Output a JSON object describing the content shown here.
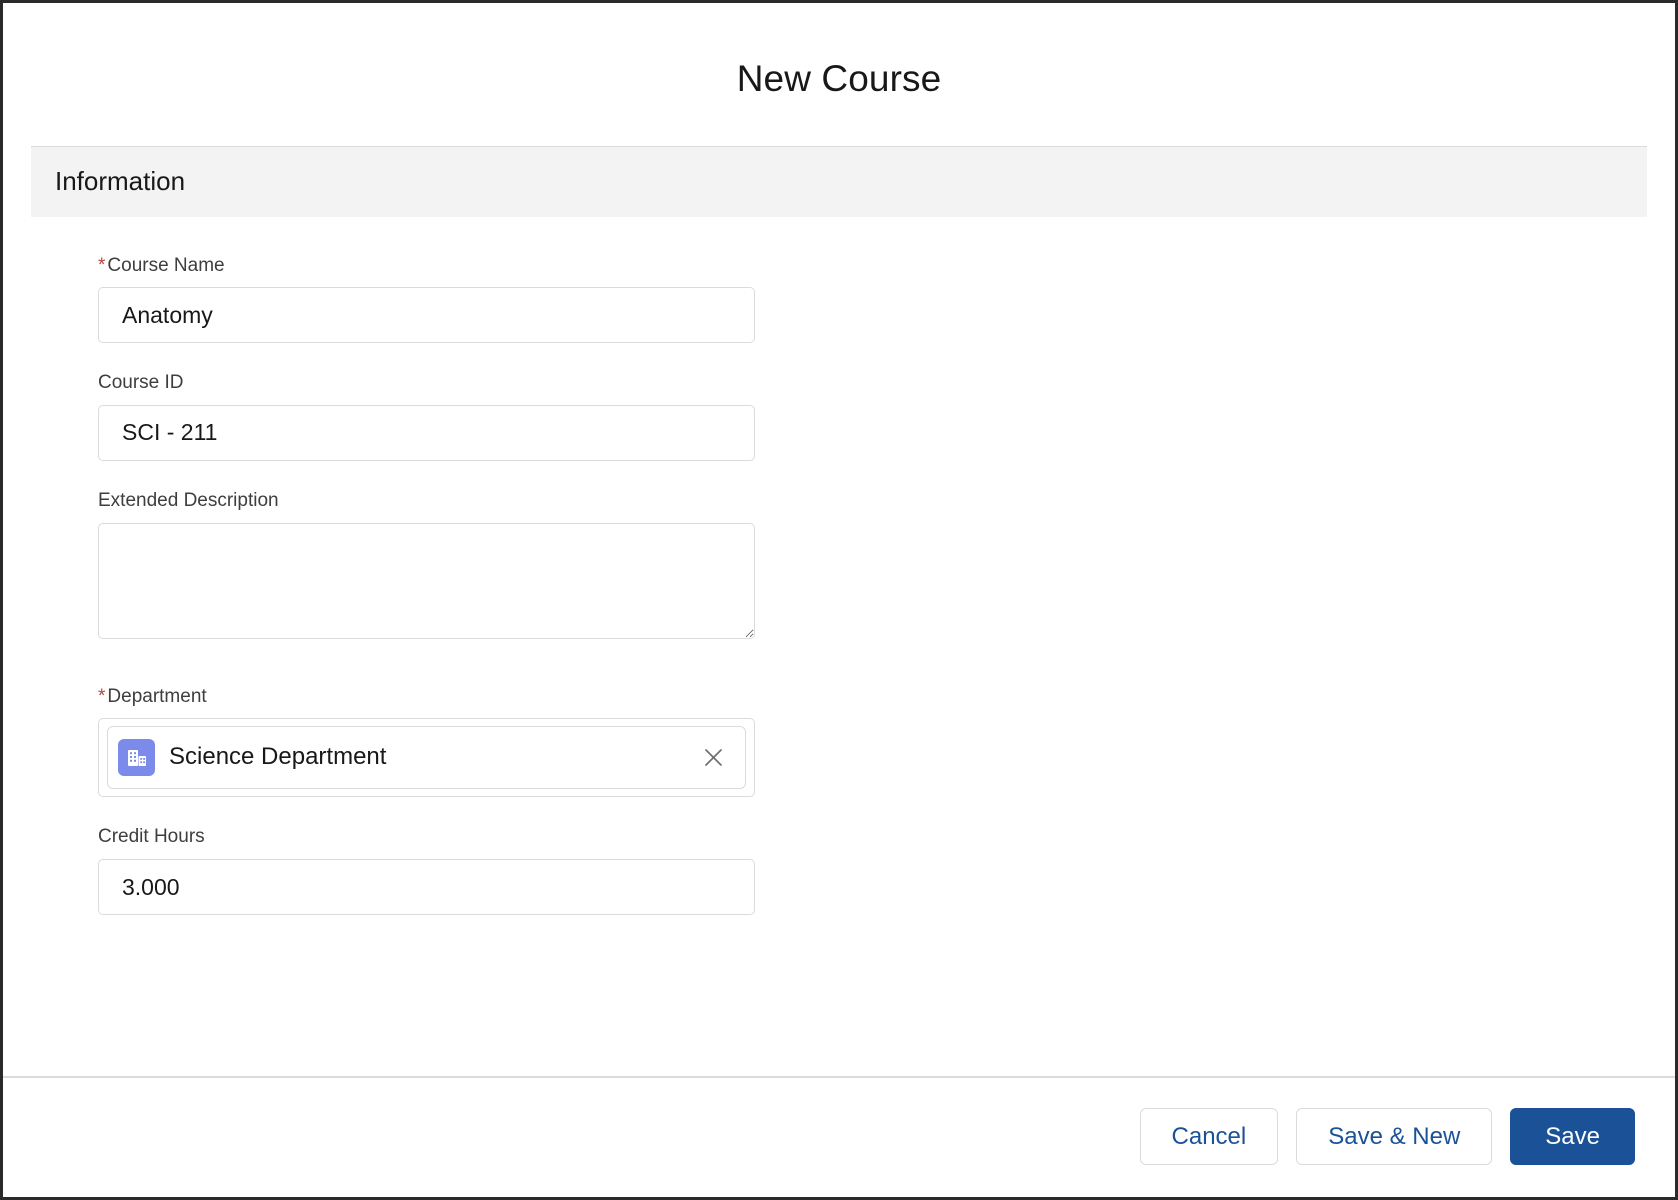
{
  "modal": {
    "title": "New Course",
    "section": {
      "heading": "Information"
    },
    "fields": {
      "course_name": {
        "label": "Course Name",
        "required_marker": "*",
        "value": "Anatomy",
        "placeholder": ""
      },
      "course_id": {
        "label": "Course ID",
        "value": "SCI - 211",
        "placeholder": ""
      },
      "extended_description": {
        "label": "Extended Description",
        "value": "",
        "placeholder": ""
      },
      "department": {
        "label": "Department",
        "required_marker": "*",
        "selected_value": "Science Department",
        "icon": "account-building-icon",
        "icon_color": "#7c8bea",
        "remove_icon": "close-icon"
      },
      "credit_hours": {
        "label": "Credit Hours",
        "value": "3.000",
        "placeholder": ""
      }
    },
    "footer": {
      "cancel_label": "Cancel",
      "save_new_label": "Save & New",
      "save_label": "Save"
    }
  },
  "colors": {
    "brand_blue": "#1b5297",
    "required_red": "#b8443a",
    "section_bg": "#f3f3f3",
    "border_grey": "#dddbda",
    "pill_icon_bg": "#7c8bea"
  }
}
